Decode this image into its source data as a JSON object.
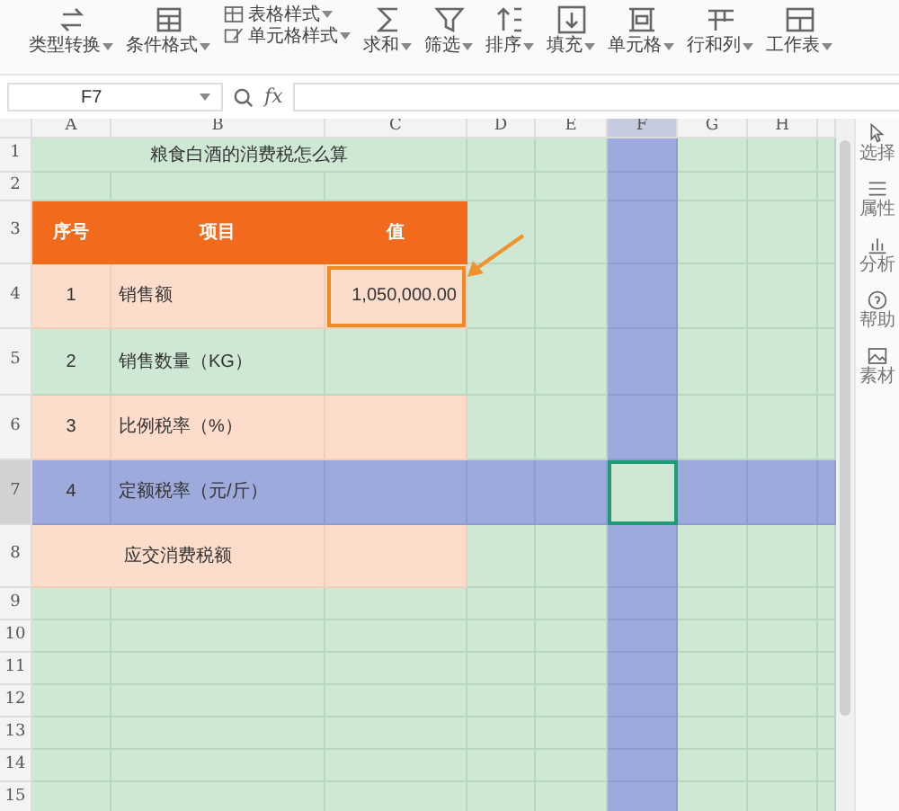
{
  "toolbar": [
    {
      "kind": "convert",
      "label": "类型转换"
    },
    {
      "kind": "grid",
      "label": "条件格式"
    },
    {
      "kind": "stack",
      "items": [
        {
          "kind": "table-style",
          "label": "表格样式"
        },
        {
          "kind": "cell-style",
          "label": "单元格样式"
        }
      ]
    },
    {
      "kind": "sum",
      "label": "求和"
    },
    {
      "kind": "filter",
      "label": "筛选"
    },
    {
      "kind": "sort",
      "label": "排序"
    },
    {
      "kind": "fill",
      "label": "填充"
    },
    {
      "kind": "cell",
      "label": "单元格"
    },
    {
      "kind": "rowcol",
      "label": "行和列"
    },
    {
      "kind": "sheet",
      "label": "工作表"
    }
  ],
  "formula_bar": {
    "name_box": "F7",
    "fx": "fx"
  },
  "columns": [
    {
      "label": "A",
      "selected": false
    },
    {
      "label": "B",
      "selected": false
    },
    {
      "label": "C",
      "selected": false
    },
    {
      "label": "D",
      "selected": false
    },
    {
      "label": "E",
      "selected": false
    },
    {
      "label": "F",
      "selected": true
    },
    {
      "label": "G",
      "selected": false
    },
    {
      "label": "H",
      "selected": false
    }
  ],
  "rows": [
    {
      "number": "1",
      "kind": "title",
      "selected": false,
      "title": "粮食白酒的消费税怎么算"
    },
    {
      "number": "2",
      "kind": "blank",
      "selected": false
    },
    {
      "number": "3",
      "kind": "header",
      "selected": false,
      "highlighted": false,
      "seq": "序号",
      "item": "项目",
      "value": "值"
    },
    {
      "number": "4",
      "kind": "peach",
      "selected": false,
      "highlighted": true,
      "seq": "1",
      "item": "销售额",
      "value": "1,050,000.00"
    },
    {
      "number": "5",
      "kind": "plain",
      "selected": false,
      "highlighted": false,
      "seq": "2",
      "item": "销售数量（KG）"
    },
    {
      "number": "6",
      "kind": "peach",
      "selected": false,
      "highlighted": false,
      "seq": "3",
      "item": "比例税率（%）"
    },
    {
      "number": "7",
      "kind": "plain",
      "selected": true,
      "highlighted": false,
      "seq": "4",
      "item": "定额税率（元/斤）"
    },
    {
      "number": "8",
      "kind": "total",
      "selected": false,
      "item": "应交消费税额"
    },
    {
      "number": "9",
      "kind": "blank",
      "selected": false
    },
    {
      "number": "10",
      "kind": "blank",
      "selected": false
    },
    {
      "number": "11",
      "kind": "blank",
      "selected": false
    },
    {
      "number": "12",
      "kind": "blank",
      "selected": false
    },
    {
      "number": "13",
      "kind": "blank",
      "selected": false
    },
    {
      "number": "14",
      "kind": "blank",
      "selected": false
    },
    {
      "number": "15",
      "kind": "blank",
      "selected": false
    }
  ],
  "sidebar": [
    {
      "kind": "select",
      "label": "选择"
    },
    {
      "kind": "props",
      "label": "属性"
    },
    {
      "kind": "analyze",
      "label": "分析"
    },
    {
      "kind": "help",
      "label": "帮助"
    },
    {
      "kind": "material",
      "label": "素材"
    }
  ]
}
